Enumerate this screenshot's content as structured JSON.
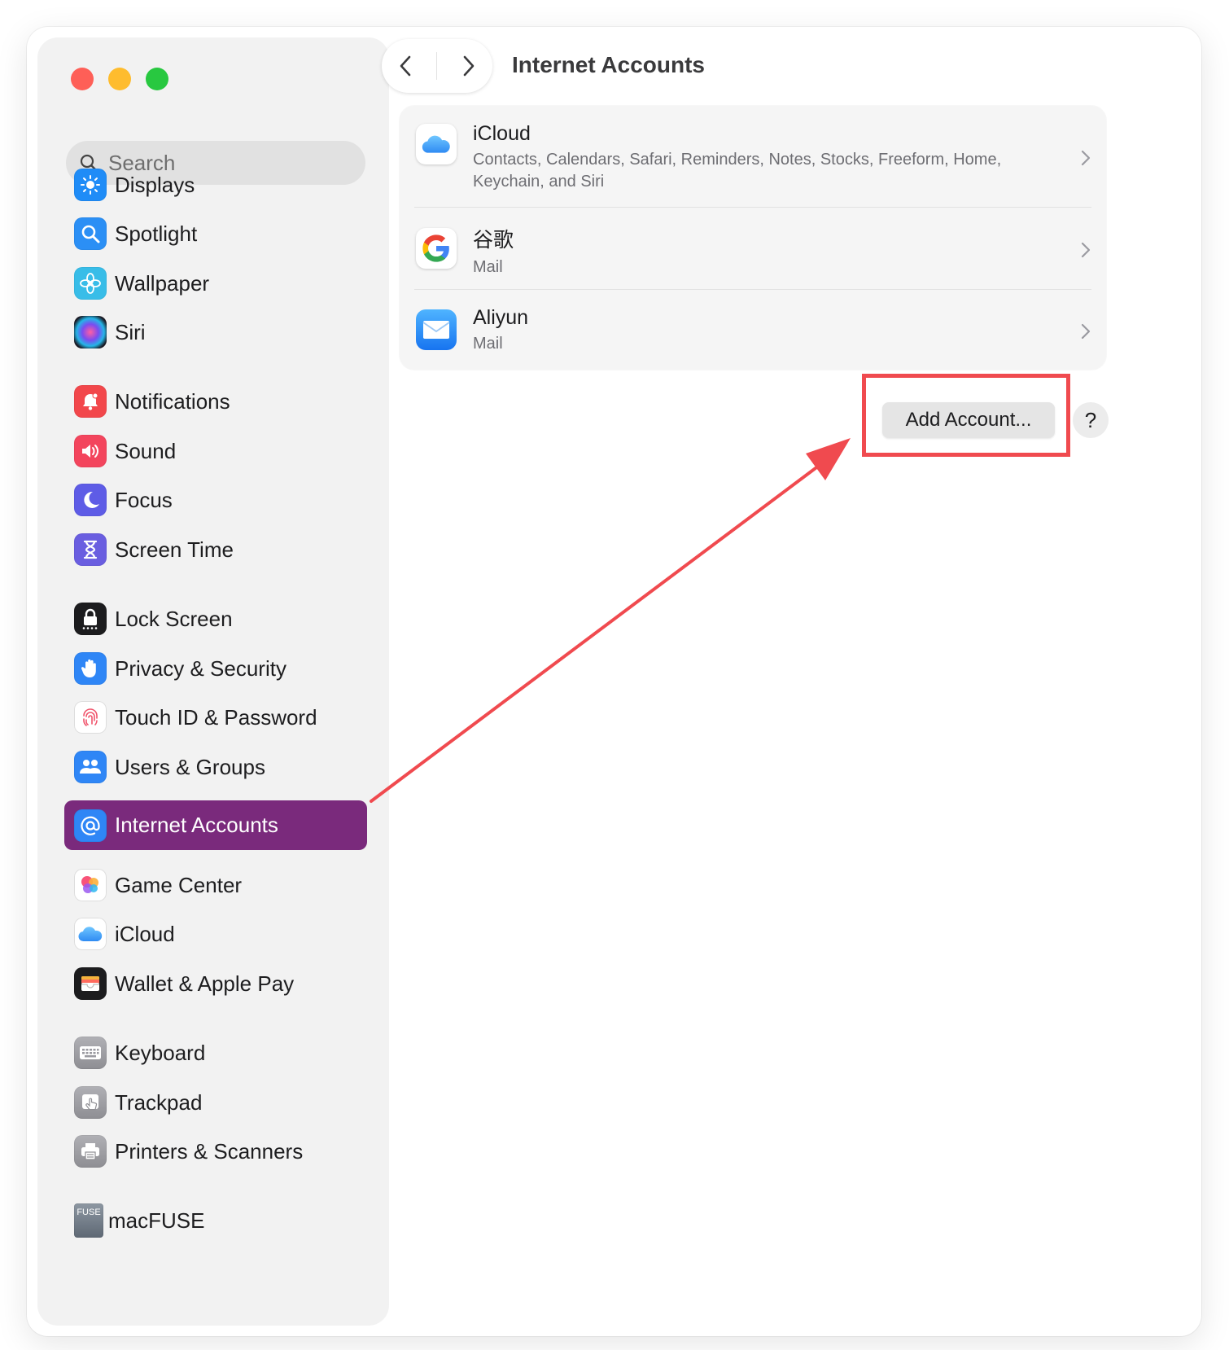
{
  "sidebar": {
    "search_placeholder": "Search",
    "items": [
      {
        "label": "Displays",
        "icon": "sun-icon",
        "color": "#1f8cf7"
      },
      {
        "label": "Spotlight",
        "icon": "magnifier-icon",
        "color": "#2b8ff5"
      },
      {
        "label": "Wallpaper",
        "icon": "flower-icon",
        "color": "#38bde8"
      },
      {
        "label": "Siri",
        "icon": "siri-icon",
        "color": "#2a2a3a"
      },
      {
        "label": "Notifications",
        "icon": "bell-icon",
        "color": "#f2474b"
      },
      {
        "label": "Sound",
        "icon": "speaker-icon",
        "color": "#f3455d"
      },
      {
        "label": "Focus",
        "icon": "moon-icon",
        "color": "#5e5ce6"
      },
      {
        "label": "Screen Time",
        "icon": "hourglass-icon",
        "color": "#6a5ee0"
      },
      {
        "label": "Lock Screen",
        "icon": "lock-icon",
        "color": "#1c1c1e"
      },
      {
        "label": "Privacy & Security",
        "icon": "hand-icon",
        "color": "#2f86f6"
      },
      {
        "label": "Touch ID & Password",
        "icon": "fingerprint-icon",
        "color": "#ffffff"
      },
      {
        "label": "Users & Groups",
        "icon": "users-icon",
        "color": "#2f86f6"
      },
      {
        "label": "Internet Accounts",
        "icon": "at-icon",
        "color": "#2f86f6"
      },
      {
        "label": "Game Center",
        "icon": "game-center-icon",
        "color": "#ffffff"
      },
      {
        "label": "iCloud",
        "icon": "cloud-icon",
        "color": "#ffffff"
      },
      {
        "label": "Wallet & Apple Pay",
        "icon": "wallet-icon",
        "color": "#1c1c1e"
      },
      {
        "label": "Keyboard",
        "icon": "keyboard-icon",
        "color": "#8e8e93"
      },
      {
        "label": "Trackpad",
        "icon": "trackpad-icon",
        "color": "#8e8e93"
      },
      {
        "label": "Printers & Scanners",
        "icon": "printer-icon",
        "color": "#8e8e93"
      },
      {
        "label": "macFUSE",
        "icon": "macfuse-icon",
        "color": "#6f7a86"
      }
    ],
    "selected_color": "#7a2a7c",
    "macfuse_icon_text": "FUSE"
  },
  "header": {
    "title": "Internet Accounts"
  },
  "accounts": [
    {
      "name": "iCloud",
      "detail": "Contacts, Calendars, Safari, Reminders, Notes, Stocks, Freeform, Home, Keychain, and Siri",
      "icon": "cloud-icon"
    },
    {
      "name": "谷歌",
      "detail": "Mail",
      "icon": "google-icon"
    },
    {
      "name": "Aliyun",
      "detail": "Mail",
      "icon": "mail-icon"
    }
  ],
  "actions": {
    "add_account": "Add Account...",
    "help": "?"
  },
  "annotation": {
    "color": "#f04a4f"
  }
}
